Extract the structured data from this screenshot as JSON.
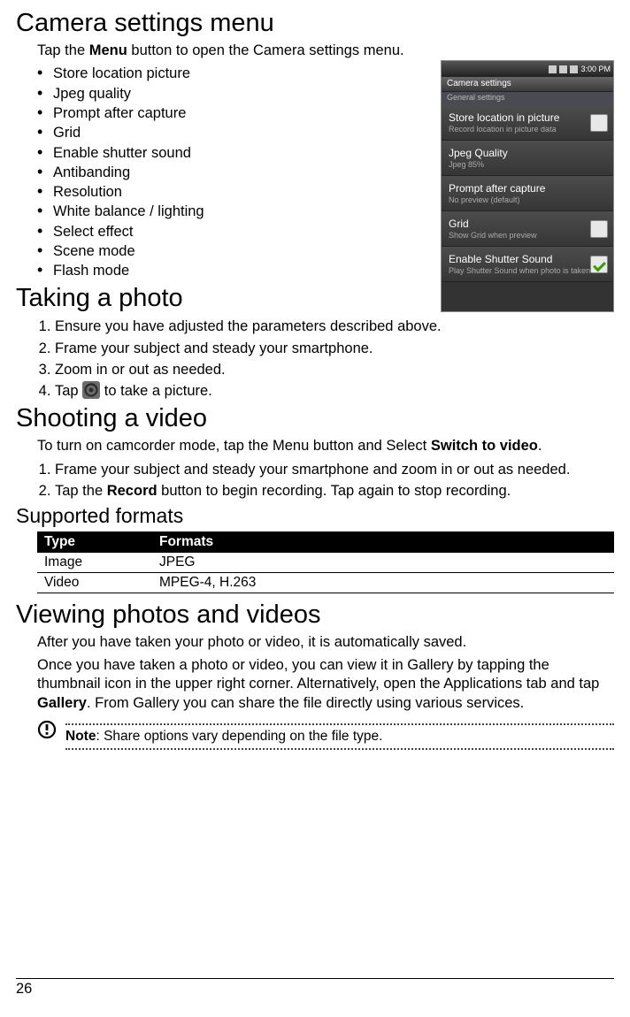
{
  "section1": {
    "heading": "Camera settings menu",
    "intro_before": "Tap the ",
    "intro_bold": "Menu",
    "intro_after": " button to open the Camera settings menu.",
    "items": [
      "Store location picture",
      "Jpeg quality",
      "Prompt after capture",
      "Grid",
      "Enable shutter sound",
      "Antibanding",
      "Resolution",
      "White balance / lighting",
      "Select effect",
      "Scene mode",
      "Flash mode"
    ]
  },
  "screenshot": {
    "time": "3:00 PM",
    "title": "Camera settings",
    "subtitle": "General settings",
    "rows": [
      {
        "title": "Store location in picture",
        "sub": "Record location in picture data",
        "check": false
      },
      {
        "title": "Jpeg Quality",
        "sub": "Jpeg 85%",
        "check": null
      },
      {
        "title": "Prompt after capture",
        "sub": "No preview (default)",
        "check": null
      },
      {
        "title": "Grid",
        "sub": "Show Grid when preview",
        "check": false
      },
      {
        "title": "Enable Shutter Sound",
        "sub": "Play Shutter Sound when photo is taken",
        "check": true
      }
    ]
  },
  "section2": {
    "heading": "Taking a photo",
    "steps_a": [
      "Ensure you have adjusted the parameters described above.",
      "Frame your subject and steady your smartphone.",
      "Zoom in or out as needed."
    ],
    "step4_before": "Tap ",
    "step4_after": " to take a picture."
  },
  "section3": {
    "heading": "Shooting a video",
    "intro_before": "To turn on camcorder mode, tap the Menu button and Select ",
    "intro_bold": "Switch to video",
    "intro_after": ".",
    "step1": "Frame your subject and steady your smartphone and zoom in or out as needed.",
    "step2_before": "Tap the ",
    "step2_bold": "Record",
    "step2_after": " button to begin recording. Tap again to stop recording."
  },
  "section4": {
    "heading": "Supported formats",
    "headers": {
      "col1": "Type",
      "col2": "Formats"
    },
    "rows": [
      {
        "c1": "Image",
        "c2": "JPEG"
      },
      {
        "c1": "Video",
        "c2": "MPEG-4, H.263"
      }
    ]
  },
  "section5": {
    "heading": "Viewing photos and videos",
    "p1": "After you have taken your photo or video, it is automatically saved.",
    "p2_before": "Once you have taken a photo or video, you can view it in Gallery by tapping the thumbnail icon in the upper right corner. Alternatively, open the Applications tab and tap ",
    "p2_bold": "Gallery",
    "p2_after": ". From Gallery you can share the file directly using various services.",
    "note_bold": "Note",
    "note_rest": ": Share options vary depending on the file type."
  },
  "page_number": "26"
}
